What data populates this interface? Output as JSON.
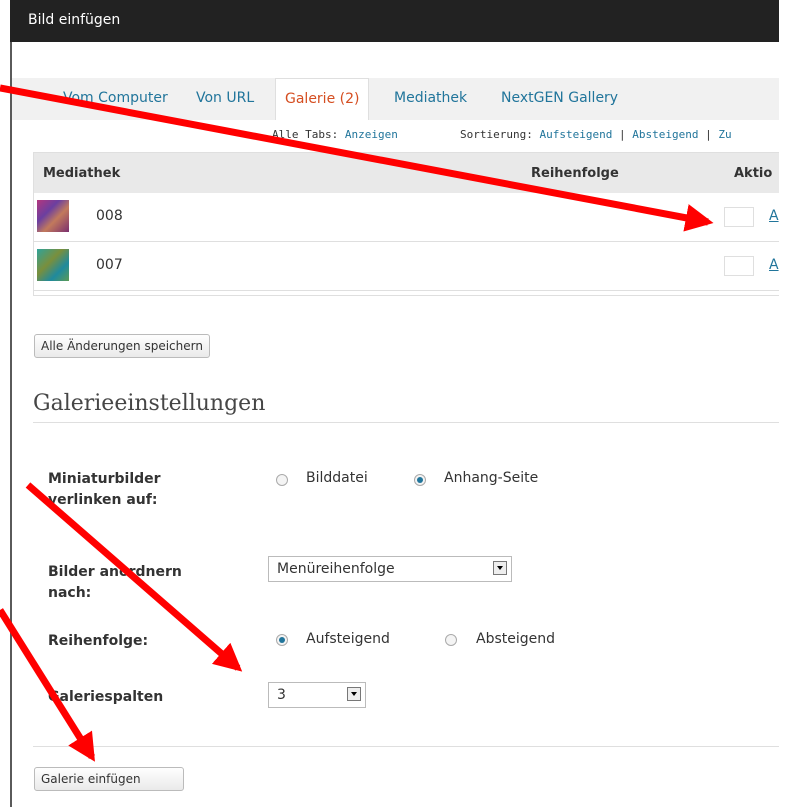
{
  "window": {
    "title": "Bild einfügen"
  },
  "tabs": [
    {
      "label": "Vom Computer"
    },
    {
      "label": "Von URL"
    },
    {
      "label": "Galerie (2)"
    },
    {
      "label": "Mediathek"
    },
    {
      "label": "NextGEN Gallery"
    }
  ],
  "subbar": {
    "all_tabs_label": "Alle Tabs:",
    "all_tabs_link": "Anzeigen",
    "sort_label": "Sortierung:",
    "sort_asc": "Aufsteigend",
    "sep": "|",
    "sort_desc": "Absteigend",
    "sort_more": "Zu"
  },
  "table": {
    "headers": {
      "media": "Mediathek",
      "order": "Reihenfolge",
      "actions": "Aktio"
    },
    "rows": [
      {
        "name": "008",
        "action": "A"
      },
      {
        "name": "007",
        "action": "A"
      }
    ]
  },
  "buttons": {
    "save_all": "Alle Änderungen speichern",
    "insert_gallery": "Galerie einfügen"
  },
  "settings": {
    "title": "Galerieeinstellungen",
    "link_to_label_1": "Miniaturbilder",
    "link_to_label_2": "verlinken auf:",
    "link_options": [
      "Bilddatei",
      "Anhang-Seite"
    ],
    "order_by_label_1": "Bilder anordnern",
    "order_by_label_2": "nach:",
    "order_by_value": "Menüreihenfolge",
    "order_label": "Reihenfolge:",
    "order_options": [
      "Aufsteigend",
      "Absteigend"
    ],
    "columns_label": "Galeriespalten",
    "columns_value": "3"
  },
  "colors": {
    "accent_link": "#21759b",
    "active_tab": "#d54e21",
    "annotation_arrow": "#ff0000",
    "titlebar": "#222222"
  }
}
